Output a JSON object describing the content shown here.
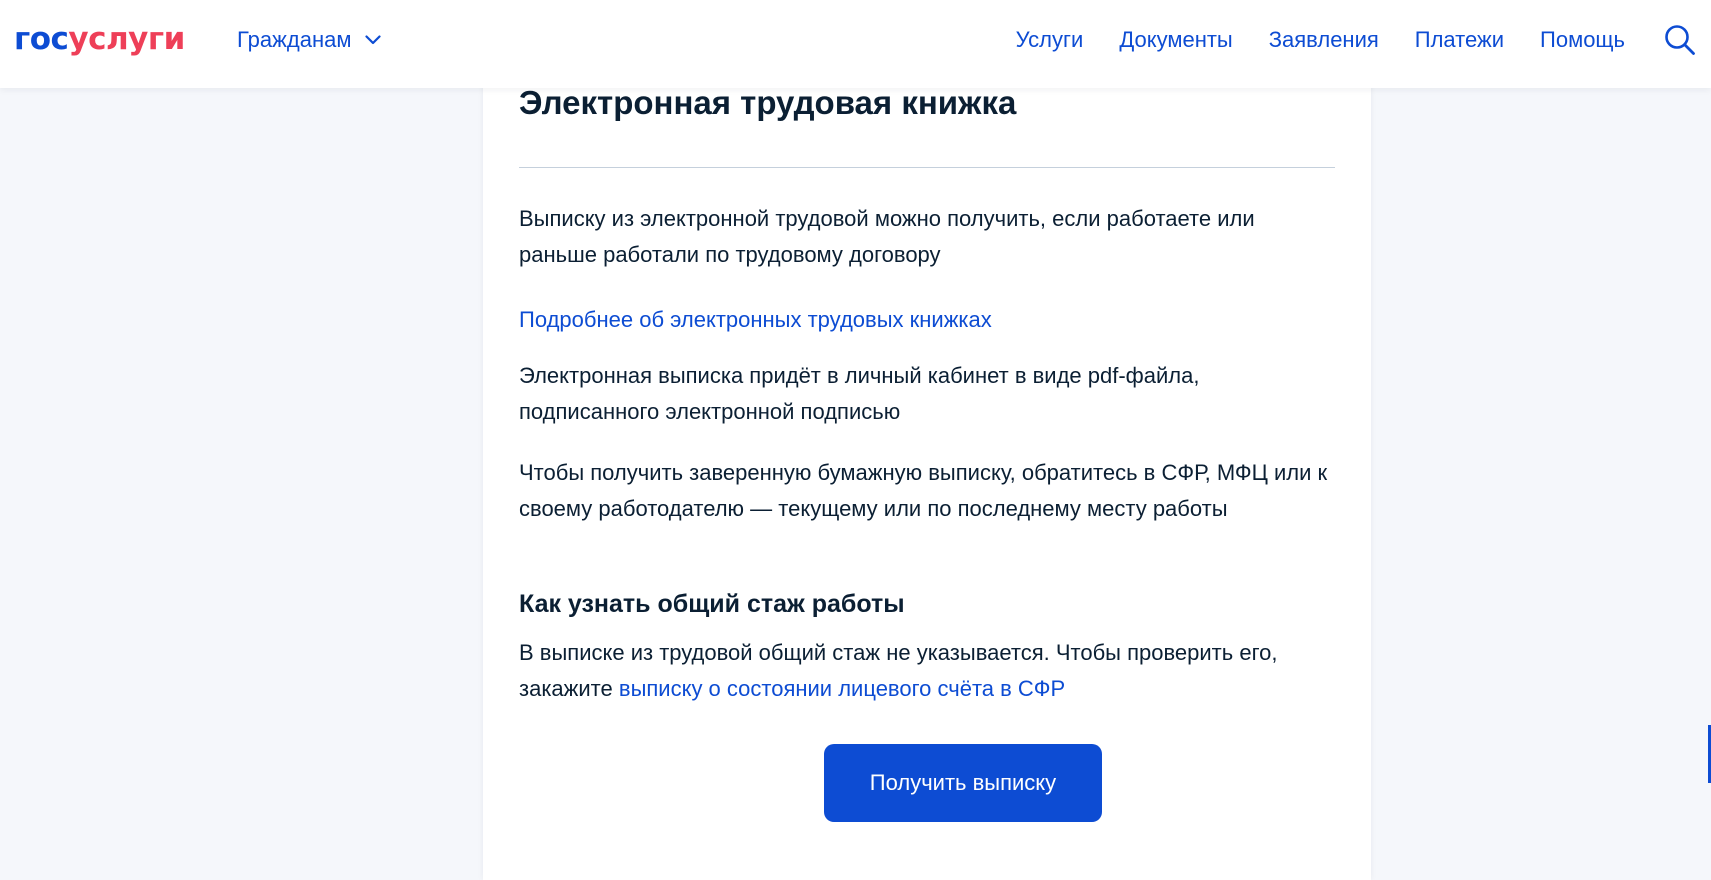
{
  "header": {
    "logo_part1": "гос",
    "logo_part2": "услуги",
    "audience_label": "Гражданам",
    "nav": [
      "Услуги",
      "Документы",
      "Заявления",
      "Платежи",
      "Помощь"
    ],
    "icons": {
      "audience_dropdown": "chevron-down-icon",
      "search": "search-icon"
    }
  },
  "article": {
    "title": "Электронная трудовая книжка",
    "intro": "Выписку из электронной трудовой можно получить, если работаете или раньше работали по трудовому договору",
    "more_link": "Подробнее об электронных трудовых книжках",
    "pdf_note": "Электронная выписка придёт в личный кабинет в виде pdf-файла, подписанного электронной подписью",
    "paper_note": "Чтобы получить заверенную бумажную выписку, обратитесь в СФР, МФЦ или к своему работодателю — текущему или по последнему месту работы",
    "experience_title": "Как узнать общий стаж работы",
    "experience_text": "В выписке из трудовой общий стаж не указывается. Чтобы проверить его, закажите",
    "experience_link": "выписку о состоянии лицевого счёта в СФР",
    "cta_label": "Получить выписку"
  },
  "colors": {
    "brand_blue": "#0d4cd3",
    "brand_red": "#ee3f58",
    "text": "#0b1f33",
    "page_background": "#f5f7fb",
    "divider": "#c5d0dc"
  }
}
